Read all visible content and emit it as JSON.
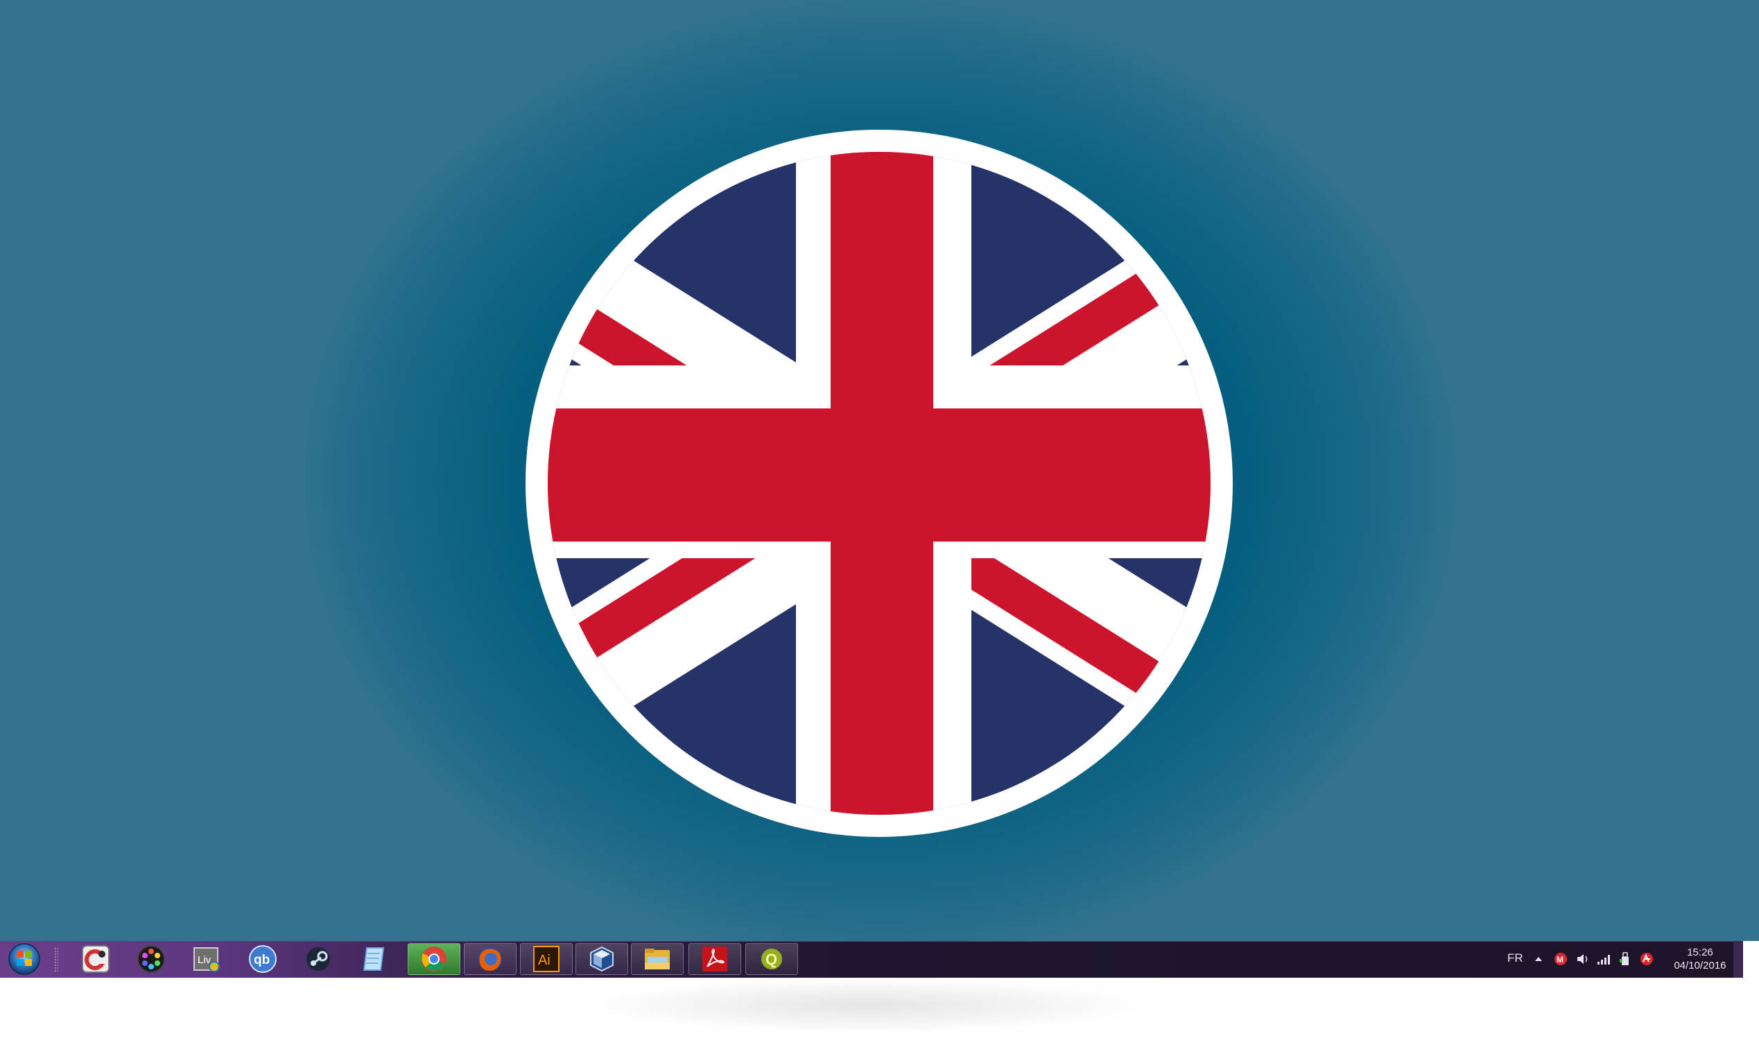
{
  "taskbar": {
    "start": {
      "icon": "windows-start-orb-icon"
    },
    "apps": [
      {
        "id": "ccleaner",
        "icon": "ccleaner-icon"
      },
      {
        "id": "davinci",
        "icon": "davinci-resolve-icon"
      },
      {
        "id": "live",
        "icon": "windows-live-icon",
        "text": "Liv"
      },
      {
        "id": "qbittorrent",
        "icon": "qbittorrent-icon",
        "text": "qb"
      },
      {
        "id": "steam",
        "icon": "steam-icon"
      },
      {
        "id": "notepad",
        "icon": "notepad-icon"
      },
      {
        "id": "chrome",
        "icon": "chrome-icon"
      },
      {
        "id": "firefox",
        "icon": "firefox-icon"
      },
      {
        "id": "illustrator",
        "icon": "adobe-illustrator-icon",
        "text": "Ai"
      },
      {
        "id": "virtualbox",
        "icon": "virtualbox-icon"
      },
      {
        "id": "explorer",
        "icon": "file-explorer-icon"
      },
      {
        "id": "acrobat",
        "icon": "adobe-acrobat-icon"
      },
      {
        "id": "qgis",
        "icon": "qgis-icon",
        "text": "Q"
      }
    ]
  },
  "tray": {
    "language": "FR",
    "icons": [
      "show-hidden-icons-arrow",
      "mega-icon",
      "volume-icon",
      "network-signal-icon",
      "usb-device-icon",
      "avira-icon"
    ],
    "mega_label": "M",
    "time": "15:26",
    "date": "04/10/2016"
  },
  "colors": {
    "desktop_background": "#33738f",
    "flag_blue": "#263368",
    "flag_red": "#cc152c",
    "flag_white": "#ffffff"
  }
}
